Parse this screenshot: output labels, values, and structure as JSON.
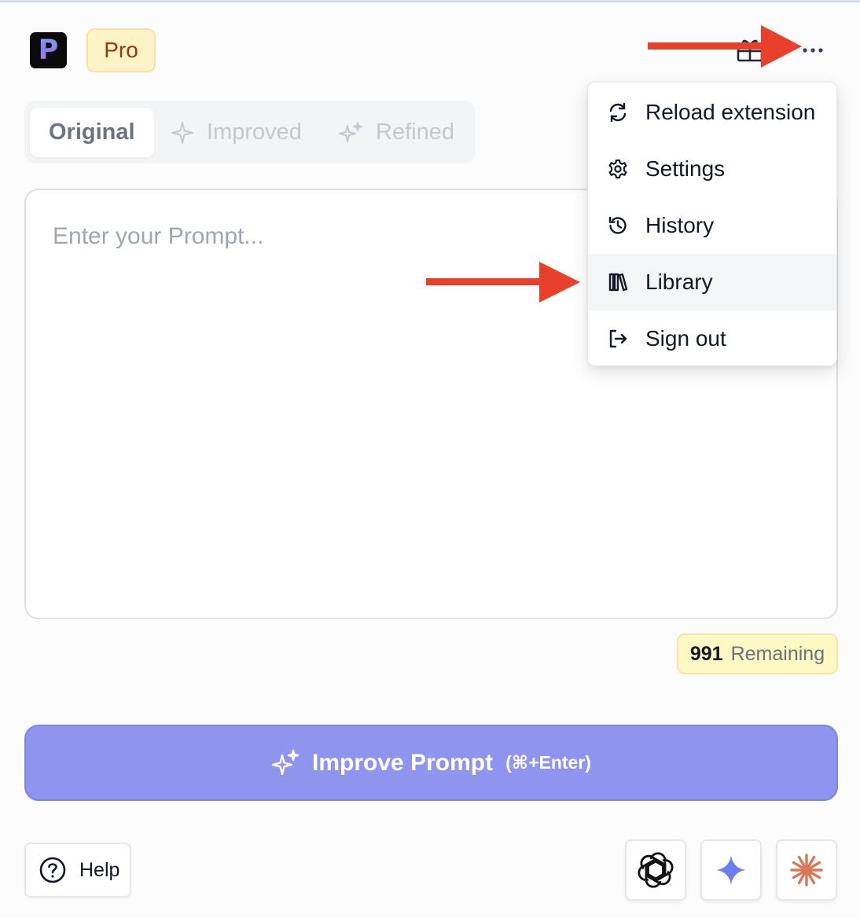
{
  "header": {
    "logo_letter": "P",
    "plan_badge": "Pro"
  },
  "tabs": [
    {
      "label": "Original",
      "active": true
    },
    {
      "label": "Improved",
      "active": false
    },
    {
      "label": "Refined",
      "active": false
    }
  ],
  "prompt": {
    "placeholder": "Enter your Prompt..."
  },
  "usage": {
    "remaining_count": "991",
    "remaining_label": "Remaining"
  },
  "improve_button": {
    "label": "Improve Prompt",
    "shortcut": "(⌘+Enter)"
  },
  "help": {
    "label": "Help"
  },
  "menu": {
    "items": [
      {
        "label": "Reload extension",
        "icon": "refresh-icon"
      },
      {
        "label": "Settings",
        "icon": "gear-icon"
      },
      {
        "label": "History",
        "icon": "history-icon"
      },
      {
        "label": "Library",
        "icon": "library-icon",
        "highlighted": true
      },
      {
        "label": "Sign out",
        "icon": "sign-out-icon"
      }
    ]
  },
  "model_buttons": [
    {
      "icon": "openai-icon"
    },
    {
      "icon": "gemini-icon"
    },
    {
      "icon": "claude-icon"
    }
  ],
  "colors": {
    "accent": "#8f94ee",
    "pro_badge_bg": "#fef3c7",
    "annotation_arrow": "#e8402a"
  }
}
